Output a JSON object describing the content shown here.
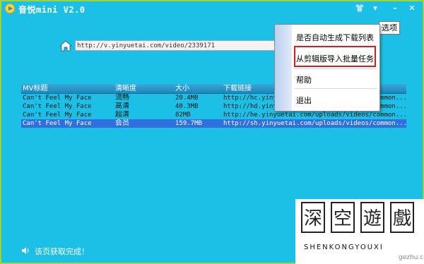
{
  "window": {
    "title": "音悦mini V2.0"
  },
  "url_bar": {
    "value": "http://v.yinyuetai.com/video/2339171"
  },
  "table": {
    "headers": [
      "MV标题",
      "清晰度",
      "大小",
      "下载链接"
    ],
    "rows": [
      {
        "title": "Can't Feel My Face",
        "quality": "流畅",
        "size": "20.4MB",
        "link": "http://hc.yinyuetai.com/uploads/videos/common..."
      },
      {
        "title": "Can't Feel My Face",
        "quality": "高清",
        "size": "40.3MB",
        "link": "http://hd.yinyuetai.com/uploads/videos/common..."
      },
      {
        "title": "Can't Feel My Face",
        "quality": "超清",
        "size": "82MB",
        "link": "http://he.yinyuetai.com/uploads/videos/common..."
      },
      {
        "title": "Can't Feel My Face",
        "quality": "会员",
        "size": "159.7MB",
        "link": "http://sh.yinyuetai.com/uploads/videos/common..."
      }
    ]
  },
  "menu": {
    "items": [
      "是否自动生成下载列表",
      "从剪辑版导入批量任务",
      "帮助",
      "退出"
    ],
    "options_label": "选项"
  },
  "status": {
    "text": "该页获取完成！"
  },
  "watermark": {
    "chars": [
      "深",
      "空",
      "遊",
      "戲"
    ],
    "sub": "SHENKONGYOUXI",
    "url": "gezhu.com"
  },
  "colors": {
    "background": "#1cc0e6",
    "border": "#9bd53a",
    "selected_row": "#2f6fe0",
    "highlight": "#d21e1e"
  }
}
